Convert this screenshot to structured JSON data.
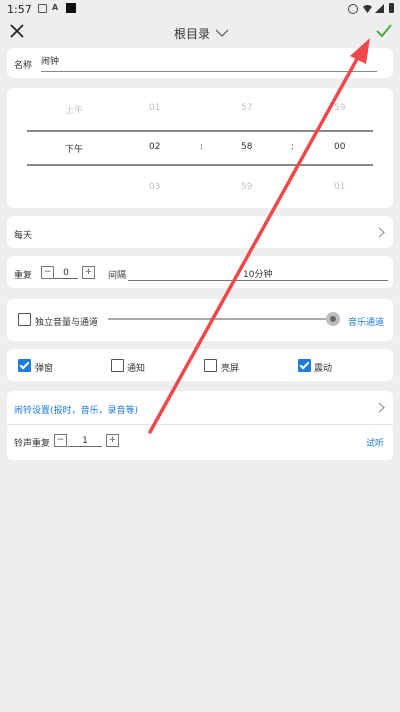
{
  "status_bar": {
    "time": "1:57",
    "icons": [
      "image-icon",
      "a-icon",
      "black-square-icon",
      "alarm-icon",
      "wifi-icon",
      "signal-icon",
      "battery-icon"
    ]
  },
  "header": {
    "title": "根目录",
    "close_icon": "close-icon",
    "dropdown_icon": "chevron-down-icon",
    "confirm_icon": "check-icon"
  },
  "name": {
    "label": "名称",
    "value": "闹钟"
  },
  "time_picker": {
    "rows": [
      {
        "ampm": "上午",
        "hour": "01",
        "minute": "57",
        "second": "59"
      },
      {
        "ampm": "下午",
        "hour": "02",
        "minute": "58",
        "second": "00"
      },
      {
        "ampm": "",
        "hour": "03",
        "minute": "59",
        "second": "01"
      }
    ],
    "separator": ":"
  },
  "repeat_days": {
    "label": "每天"
  },
  "repeat": {
    "label": "重复",
    "minus": "−",
    "plus": "+",
    "count": "0",
    "interval_label": "间隔",
    "interval_value": "10分钟"
  },
  "volume": {
    "label": "独立音量与通道",
    "channel": "音乐通道",
    "checked": false,
    "level": 1.0
  },
  "options": [
    {
      "label": "弹窗",
      "checked": true
    },
    {
      "label": "通知",
      "checked": false
    },
    {
      "label": "亮屏",
      "checked": false
    },
    {
      "label": "震动",
      "checked": true
    }
  ],
  "ring_settings": {
    "label": "闹铃设置(报时，音乐，录音等)"
  },
  "ring_repeat": {
    "label": "铃声重复",
    "minus": "−",
    "plus": "+",
    "count": "1",
    "trial": "试听"
  },
  "colors": {
    "accent": "#1e7be0",
    "confirm": "#3aaa35",
    "annotation_arrow": "#f04848",
    "background": "#eeeeee"
  }
}
